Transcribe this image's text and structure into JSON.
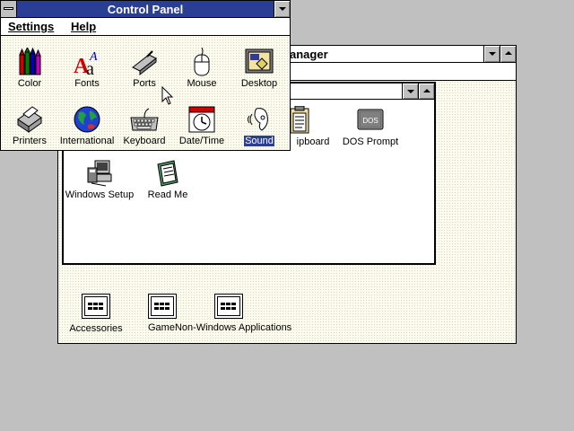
{
  "program_manager": {
    "title_visible": "anager",
    "group_window": {
      "icons": [
        {
          "label": "ipboard"
        },
        {
          "label": "DOS Prompt",
          "glyph_text": "DOS"
        },
        {
          "label": "Windows Setup"
        },
        {
          "label": "Read Me"
        }
      ]
    },
    "groups": [
      {
        "label": "Accessories"
      },
      {
        "label": "GameNon-Windows Applications"
      }
    ]
  },
  "control_panel": {
    "title": "Control Panel",
    "menu": {
      "settings": "Settings",
      "help": "Help"
    },
    "icons": [
      {
        "label": "Color",
        "icon": "color-icon"
      },
      {
        "label": "Fonts",
        "icon": "fonts-icon"
      },
      {
        "label": "Ports",
        "icon": "ports-icon"
      },
      {
        "label": "Mouse",
        "icon": "mouse-icon"
      },
      {
        "label": "Desktop",
        "icon": "desktop-icon"
      },
      {
        "label": "Printers",
        "icon": "printers-icon"
      },
      {
        "label": "International",
        "icon": "international-icon"
      },
      {
        "label": "Keyboard",
        "icon": "keyboard-icon"
      },
      {
        "label": "Date/Time",
        "icon": "date-time-icon"
      },
      {
        "label": "Sound",
        "icon": "sound-icon",
        "selected": true
      }
    ]
  },
  "colors": {
    "active_title": "#2a3f93",
    "selection": "#2a3f93",
    "desktop": "#c0c0c0"
  }
}
